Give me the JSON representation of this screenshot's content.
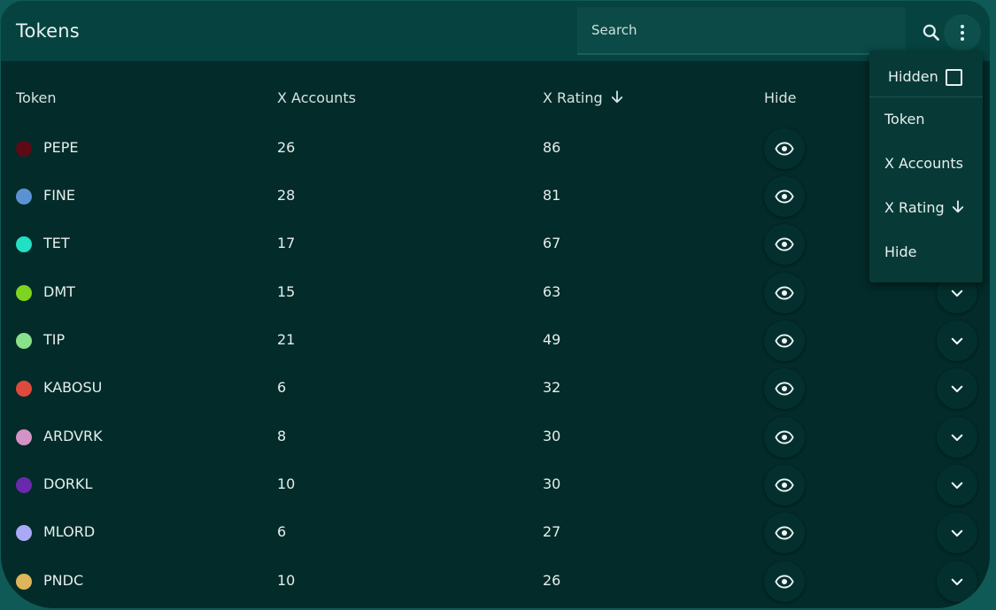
{
  "header": {
    "title": "Tokens",
    "search_placeholder": "Search",
    "search_icon": "search-icon",
    "more_icon": "more-vert-icon"
  },
  "table": {
    "columns": [
      "Token",
      "X Accounts",
      "X Rating",
      "Hide"
    ],
    "sort": {
      "column": "X Rating",
      "direction": "desc",
      "icon": "arrow-down-icon"
    },
    "rows": [
      {
        "token": "PEPE",
        "color": "#5e0a16",
        "accounts": "26",
        "rating": "86"
      },
      {
        "token": "FINE",
        "color": "#5b93d2",
        "accounts": "28",
        "rating": "81"
      },
      {
        "token": "TET",
        "color": "#22e0c4",
        "accounts": "17",
        "rating": "67"
      },
      {
        "token": "DMT",
        "color": "#7fd321",
        "accounts": "15",
        "rating": "63"
      },
      {
        "token": "TIP",
        "color": "#88e08a",
        "accounts": "21",
        "rating": "49"
      },
      {
        "token": "KABOSU",
        "color": "#e0493e",
        "accounts": "6",
        "rating": "32"
      },
      {
        "token": "ARDVRK",
        "color": "#d394c5",
        "accounts": "8",
        "rating": "30"
      },
      {
        "token": "DORKL",
        "color": "#6a28ad",
        "accounts": "10",
        "rating": "30"
      },
      {
        "token": "MLORD",
        "color": "#a9a9f6",
        "accounts": "6",
        "rating": "27"
      },
      {
        "token": "PNDC",
        "color": "#ddb55a",
        "accounts": "10",
        "rating": "26"
      }
    ]
  },
  "menu": {
    "hidden_label": "Hidden",
    "hidden_checked": false,
    "items": [
      "Token",
      "X Accounts",
      "X Rating",
      "Hide"
    ]
  },
  "colors": {
    "background": "#022b29",
    "topbar": "#064340",
    "text": "#e4eeed"
  }
}
